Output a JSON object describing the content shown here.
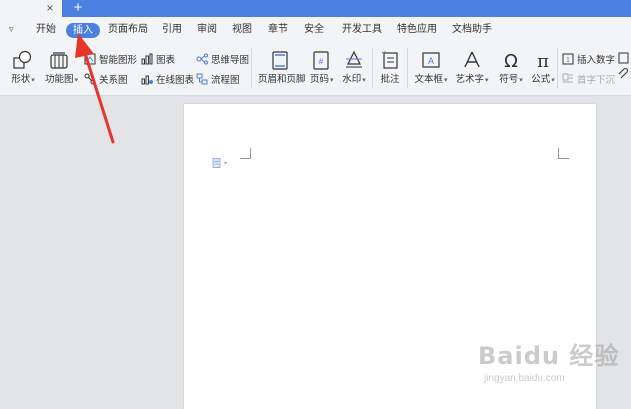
{
  "titlebar": {
    "close_glyph": "×",
    "new_tab_glyph": "+"
  },
  "menu": {
    "collapse_glyph": "▿",
    "items": [
      "开始",
      "插入",
      "页面布局",
      "引用",
      "审阅",
      "视图",
      "章节",
      "安全",
      "开发工具",
      "特色应用",
      "文档助手"
    ],
    "active": "插入"
  },
  "toolbar": {
    "shape": "形状",
    "function_chart": "功能图",
    "smart_art": "智能图形",
    "chart": "图表",
    "mind_map": "思维导图",
    "relation": "关系图",
    "online_chart": "在线图表",
    "flowchart": "流程图",
    "header_footer": "页眉和页脚",
    "page_number": "页码",
    "watermark": "水印",
    "comment": "批注",
    "textbox": "文本框",
    "wordart": "艺术字",
    "symbol": "符号",
    "formula": "公式",
    "insert_number": "插入数字",
    "drop_cap": "首字下沉"
  },
  "icons": [
    "close-icon",
    "plus-icon",
    "chevron-down-icon",
    "shape-icon",
    "function-chart-icon",
    "smart-art-icon",
    "chart-icon",
    "mind-map-icon",
    "relation-icon",
    "online-chart-icon",
    "flowchart-icon",
    "header-footer-icon",
    "page-number-icon",
    "watermark-icon",
    "comment-icon",
    "textbox-icon",
    "wordart-icon",
    "symbol-icon",
    "formula-icon",
    "insert-number-icon",
    "drop-cap-icon",
    "attach-icon",
    "paragraph-icon"
  ],
  "colors": {
    "accent": "#4b7fe0",
    "annotation_arrow": "#e8352b",
    "page": "#ffffff",
    "workspace": "#e3e4e6"
  },
  "watermark_text": {
    "logo": "Baidu 经验",
    "url": "jingyan.baidu.com"
  }
}
